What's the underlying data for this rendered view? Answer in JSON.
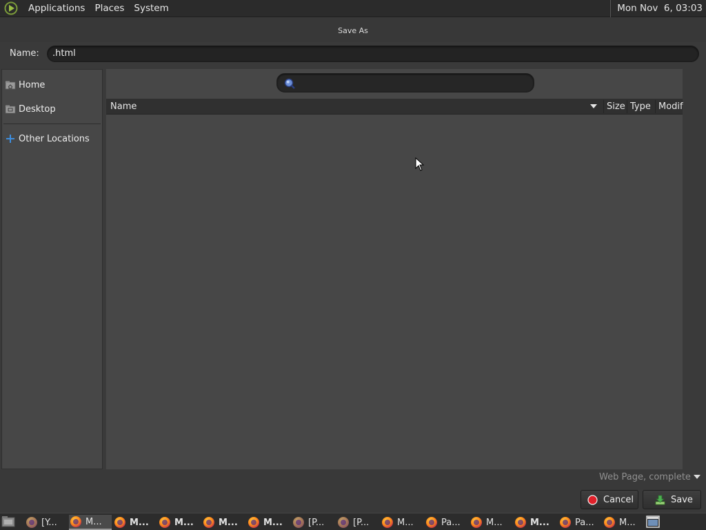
{
  "top_panel": {
    "menus": [
      "Applications",
      "Places",
      "System"
    ],
    "clock": "Mon Nov  6, 03:03"
  },
  "dialog": {
    "title": "Save As",
    "name_label": "Name:",
    "name_value": ".html",
    "search_placeholder": ""
  },
  "sidebar": {
    "items": [
      {
        "label": "Home",
        "icon": "home-folder-icon"
      },
      {
        "label": "Desktop",
        "icon": "desktop-folder-icon"
      },
      {
        "label": "Other Locations",
        "icon": "plus-icon"
      }
    ]
  },
  "file_list": {
    "columns": [
      "Name",
      "Size",
      "Type",
      "Modif"
    ],
    "rows": []
  },
  "footer": {
    "filter_value": "Web Page, complete",
    "cancel_label": "Cancel",
    "save_label": "Save"
  },
  "taskbar": {
    "items": [
      {
        "label": "[Y...",
        "style": "dim"
      },
      {
        "label": "M...",
        "style": "active"
      },
      {
        "label": "M...",
        "style": "bold"
      },
      {
        "label": "M...",
        "style": "bold"
      },
      {
        "label": "M...",
        "style": "bold"
      },
      {
        "label": "M...",
        "style": "bold"
      },
      {
        "label": "[P...",
        "style": "dim"
      },
      {
        "label": "[P...",
        "style": "dim"
      },
      {
        "label": "M...",
        "style": "normal"
      },
      {
        "label": "Pa...",
        "style": "normal"
      },
      {
        "label": "M...",
        "style": "normal"
      },
      {
        "label": "M...",
        "style": "bold"
      },
      {
        "label": "Pa...",
        "style": "normal"
      },
      {
        "label": "M...",
        "style": "normal"
      }
    ]
  },
  "colors": {
    "panel_bg": "#2b2b2b",
    "dialog_bg": "#393939",
    "pane_bg": "#474747",
    "header_bg": "#303030",
    "cancel_icon_red": "#e0202a",
    "save_icon_green": "#4caf50"
  }
}
